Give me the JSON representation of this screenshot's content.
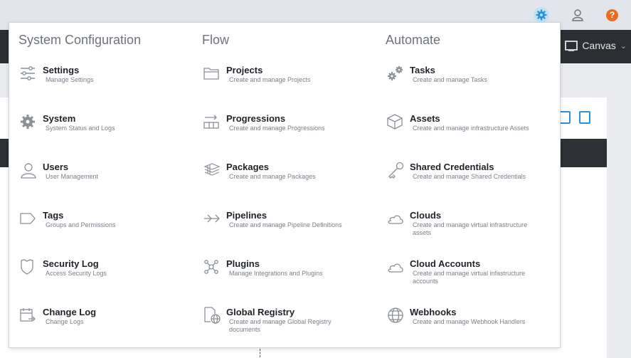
{
  "header": {
    "canvas_label": "Canvas"
  },
  "menu": {
    "columns": [
      {
        "title": "System Configuration",
        "items": [
          {
            "label": "Settings",
            "desc": "Manage Settings",
            "icon": "sliders-icon"
          },
          {
            "label": "System",
            "desc": "System Status and Logs",
            "icon": "gear-icon"
          },
          {
            "label": "Users",
            "desc": "User Management",
            "icon": "user-icon"
          },
          {
            "label": "Tags",
            "desc": "Groups and Permissions",
            "icon": "tag-icon"
          },
          {
            "label": "Security Log",
            "desc": "Access Security Logs",
            "icon": "shield-icon"
          },
          {
            "label": "Change Log",
            "desc": "Change Logs",
            "icon": "calendar-icon"
          }
        ]
      },
      {
        "title": "Flow",
        "items": [
          {
            "label": "Projects",
            "desc": "Create and manage Projects",
            "icon": "folder-icon"
          },
          {
            "label": "Progressions",
            "desc": "Create and manage Progressions",
            "icon": "progression-icon"
          },
          {
            "label": "Packages",
            "desc": "Create and manage Packages",
            "icon": "stack-icon"
          },
          {
            "label": "Pipelines",
            "desc": "Create and manage Pipeline Definitions",
            "icon": "pipeline-icon"
          },
          {
            "label": "Plugins",
            "desc": "Manage Integrations and Plugins",
            "icon": "plugin-icon"
          },
          {
            "label": "Global Registry",
            "desc": "Create and manage Global Registry documents",
            "icon": "registry-icon"
          }
        ]
      },
      {
        "title": "Automate",
        "items": [
          {
            "label": "Tasks",
            "desc": "Create and manage Tasks",
            "icon": "gears-icon"
          },
          {
            "label": "Assets",
            "desc": "Create and manage infrastructure Assets",
            "icon": "cube-icon"
          },
          {
            "label": "Shared Credentials",
            "desc": "Create and manage Shared Credentials",
            "icon": "key-icon"
          },
          {
            "label": "Clouds",
            "desc": "Create and manage virtual infrastructure assets",
            "icon": "cloud-icon"
          },
          {
            "label": "Cloud Accounts",
            "desc": "Create and manage virtual infastructure accounts",
            "icon": "cloud-account-icon"
          },
          {
            "label": "Webhooks",
            "desc": "Create and manage Webhook Handlers",
            "icon": "globe-icon"
          }
        ]
      }
    ]
  },
  "colors": {
    "accent": "#2c8fdc",
    "help": "#e96c1f",
    "nav_bg": "#2b2e33"
  }
}
